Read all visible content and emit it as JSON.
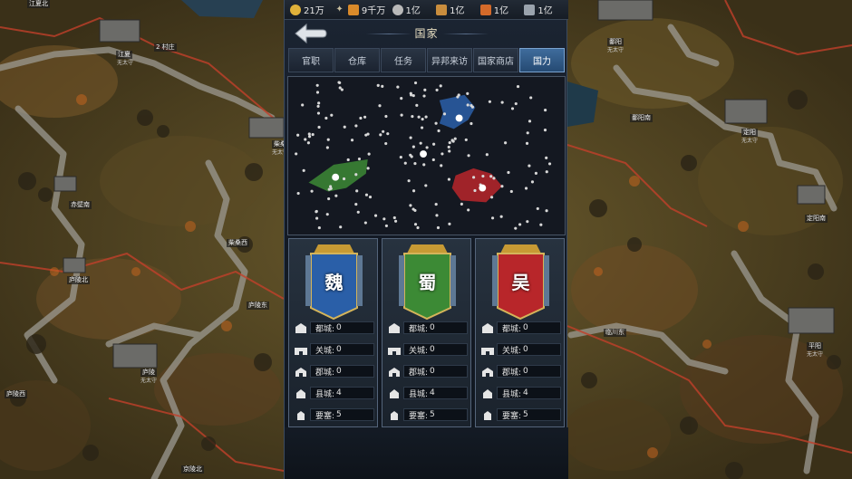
{
  "resources": [
    {
      "icon": "gold-coin-icon",
      "value": "21万",
      "color": "#e0b13a"
    },
    {
      "icon": "arrow-icon",
      "value": "",
      "color": "#c9c0a0"
    },
    {
      "icon": "shield-icon",
      "value": "9千万",
      "color": "#d98a2a"
    },
    {
      "icon": "silver-coin-icon",
      "value": "1亿",
      "color": "#b9b9b9"
    },
    {
      "icon": "wood-icon",
      "value": "1亿",
      "color": "#c98d3d"
    },
    {
      "icon": "food-icon",
      "value": "1亿",
      "color": "#d46a2a"
    },
    {
      "icon": "iron-icon",
      "value": "1亿",
      "color": "#9aa3ad"
    }
  ],
  "page_title": "国家",
  "tabs": [
    {
      "label": "官职",
      "active": false
    },
    {
      "label": "仓库",
      "active": false
    },
    {
      "label": "任务",
      "active": false
    },
    {
      "label": "异邦来访",
      "active": false
    },
    {
      "label": "国家商店",
      "active": false
    },
    {
      "label": "国力",
      "active": true
    }
  ],
  "factions": [
    {
      "name": "魏",
      "color": "#2a5fa8",
      "stats": [
        {
          "label": "都城:",
          "value": "0"
        },
        {
          "label": "关城:",
          "value": "0"
        },
        {
          "label": "郡城:",
          "value": "0"
        },
        {
          "label": "县城:",
          "value": "4"
        },
        {
          "label": "要塞:",
          "value": "5"
        }
      ]
    },
    {
      "name": "蜀",
      "color": "#3c8a35",
      "stats": [
        {
          "label": "都城:",
          "value": "0"
        },
        {
          "label": "关城:",
          "value": "0"
        },
        {
          "label": "郡城:",
          "value": "0"
        },
        {
          "label": "县城:",
          "value": "4"
        },
        {
          "label": "要塞:",
          "value": "5"
        }
      ]
    },
    {
      "name": "吴",
      "color": "#b8262a",
      "stats": [
        {
          "label": "都城:",
          "value": "0"
        },
        {
          "label": "关城:",
          "value": "0"
        },
        {
          "label": "郡城:",
          "value": "0"
        },
        {
          "label": "县城:",
          "value": "4"
        },
        {
          "label": "要塞:",
          "value": "5"
        }
      ]
    }
  ],
  "map_labels": {
    "left": [
      {
        "name": "江夏北",
        "sub": ""
      },
      {
        "name": "江夏",
        "sub": "无太守"
      },
      {
        "name": "2 村庄",
        "sub": ""
      },
      {
        "name": "赤壁南",
        "sub": ""
      },
      {
        "name": "柴桑西",
        "sub": ""
      },
      {
        "name": "庐陵北",
        "sub": ""
      },
      {
        "name": "庐陵东",
        "sub": ""
      },
      {
        "name": "庐陵",
        "sub": "无太守"
      },
      {
        "name": "庐陵西",
        "sub": ""
      },
      {
        "name": "柴桑",
        "sub": "无太守"
      },
      {
        "name": "京陵北",
        "sub": ""
      }
    ],
    "right": [
      {
        "name": "鄱阳",
        "sub": "无太守"
      },
      {
        "name": "鄱阳南",
        "sub": ""
      },
      {
        "name": "定阳",
        "sub": "无太守"
      },
      {
        "name": "定阳南",
        "sub": ""
      },
      {
        "name": "临川东",
        "sub": ""
      },
      {
        "name": "平阳",
        "sub": "无太守"
      }
    ]
  }
}
